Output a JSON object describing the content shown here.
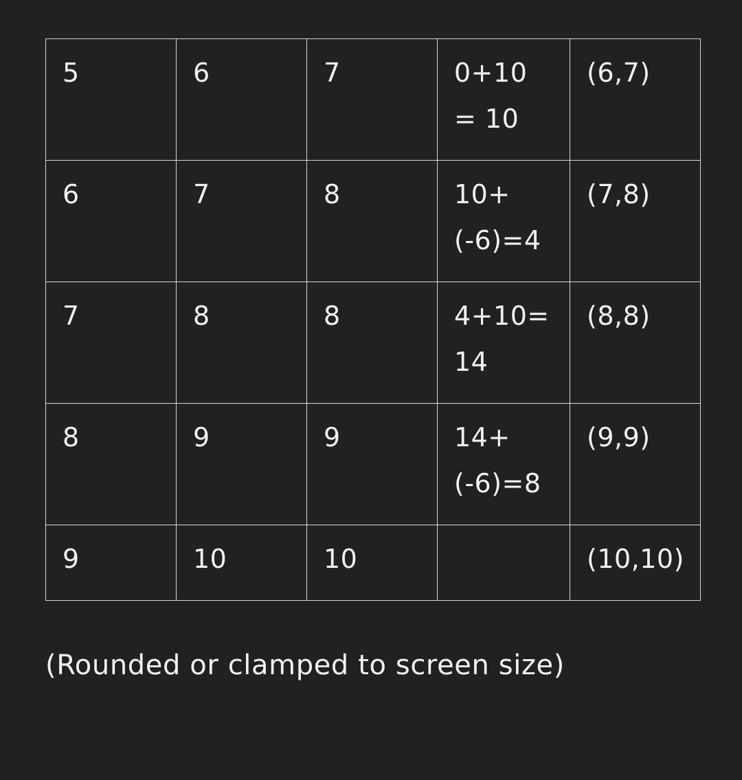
{
  "table": {
    "rows": [
      [
        "5",
        "6",
        "7",
        "0+10\n= 10",
        "(6,7)"
      ],
      [
        "6",
        "7",
        "8",
        "10+\n(-6)=4",
        "(7,8)"
      ],
      [
        "7",
        "8",
        "8",
        "4+10=\n14",
        "(8,8)"
      ],
      [
        "8",
        "9",
        "9",
        "14+\n(-6)=8",
        "(9,9)"
      ],
      [
        "9",
        "10",
        "10",
        "",
        "(10,10)"
      ]
    ]
  },
  "footer": {
    "note": "(Rounded or clamped to screen size)"
  },
  "colors": {
    "background": "#212121",
    "text": "#f2f2f2",
    "grid_line": "#d8d8d8"
  }
}
